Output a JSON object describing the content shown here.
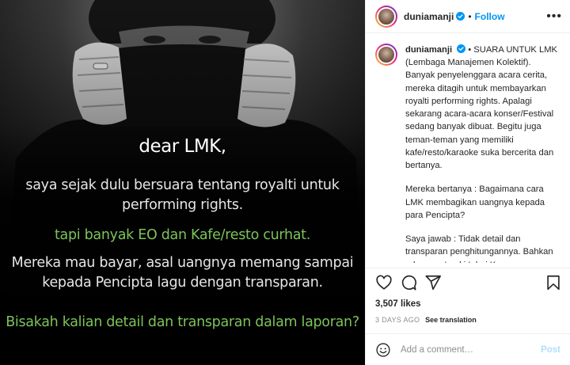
{
  "media": {
    "title": "dear LMK,",
    "line1": "saya sejak dulu bersuara tentang royalti untuk performing rights.",
    "line2": "tapi banyak EO dan Kafe/resto curhat.",
    "line3": "Mereka mau bayar, asal uangnya memang sampai kepada Pencipta lagu dengan transparan.",
    "line4": "Bisakah kalian detail dan transparan dalam laporan?",
    "colors": {
      "highlight": "#7cc35a",
      "text": "#e6e6e6"
    }
  },
  "header": {
    "username": "duniamanji",
    "separator": "•",
    "follow_label": "Follow",
    "more_label": "•••",
    "verified_icon": "verified-badge-icon"
  },
  "caption": {
    "username": "duniamanji",
    "p1": "• SUARA UNTUK LMK (Lembaga Manajemen Kolektif). Banyak penyelenggara acara cerita, mereka ditagih untuk membayarkan royalti performing rights. Apalagi sekarang acara-acara konser/Festival sedang banyak dibuat. Begitu juga teman-teman yang memiliki kafe/resto/karaoke suka bercerita dan bertanya.",
    "p2": "Mereka bertanya : Bagaimana cara LMK membagikan uangnya kepada para Pencipta?",
    "p3": "Saya jawab : Tidak detail dan transparan penghitungannya. Bahkan ada uang 'parkir' dari Komposer yang tidak mengambil royaltinya (karena tidak tahu atau tidak mendaftar)"
  },
  "actions": {
    "icons": [
      "heart-icon",
      "comment-icon",
      "share-icon",
      "bookmark-icon"
    ]
  },
  "stats": {
    "likes": "3,507 likes",
    "time": "3 DAYS AGO",
    "translation": "See translation"
  },
  "comment": {
    "placeholder": "Add a comment…",
    "post_label": "Post",
    "emoji_icon": "smiley-icon"
  },
  "colors": {
    "accent": "#0095f6",
    "muted": "#8e8e8e",
    "border": "#efefef"
  }
}
